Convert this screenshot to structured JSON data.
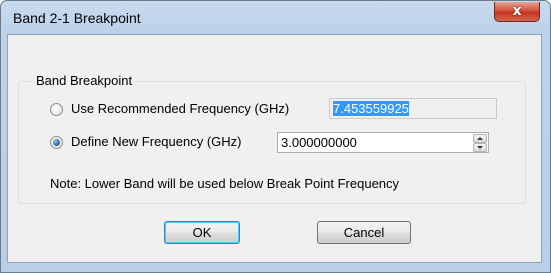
{
  "window": {
    "title": "Band 2-1 Breakpoint",
    "close_glyph": "x"
  },
  "group": {
    "label": "Band Breakpoint"
  },
  "options": [
    {
      "label": "Use Recommended Frequency (GHz)",
      "value": "7.453559925",
      "checked": false
    },
    {
      "label": "Define New Frequency (GHz)",
      "value": "3.000000000",
      "checked": true
    }
  ],
  "note": "Note: Lower Band will be used below Break Point Frequency",
  "buttons": {
    "ok": "OK",
    "cancel": "Cancel"
  },
  "colors": {
    "selection": "#3399ff",
    "close_button": "#c4331e",
    "title_bar": "#bcd2ea"
  }
}
